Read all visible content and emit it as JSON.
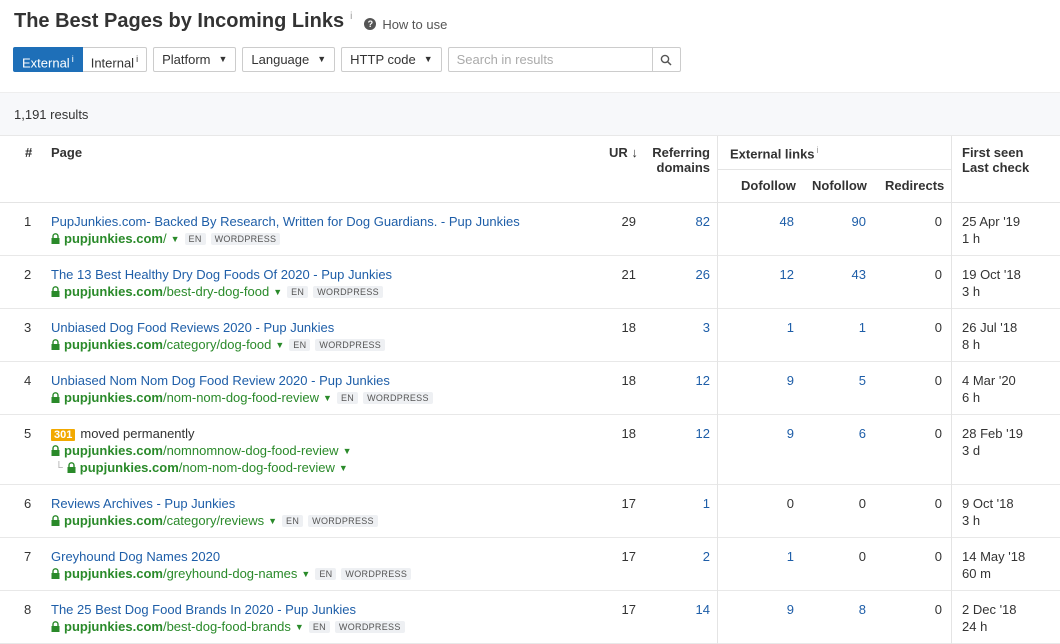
{
  "header": {
    "title": "The Best Pages by Incoming Links",
    "title_info": "i",
    "how_to_use": "How to use"
  },
  "toolbar": {
    "external_label": "External",
    "internal_label": "Internal",
    "info_glyph": "i",
    "platform_label": "Platform",
    "language_label": "Language",
    "http_code_label": "HTTP code",
    "search_placeholder": "Search in results"
  },
  "results": {
    "count_label": "1,191 results"
  },
  "table": {
    "headers": {
      "num": "#",
      "page": "Page",
      "ur": "UR",
      "ur_sort": "↓",
      "referring_1": "Referring",
      "referring_2": "domains",
      "external_links": "External links",
      "external_info": "i",
      "dofollow": "Dofollow",
      "nofollow": "Nofollow",
      "redirects": "Redirects",
      "first_seen": "First seen",
      "last_check": "Last check"
    },
    "rows": [
      {
        "n": "1",
        "title": "PupJunkies.com- Backed By Research, Written for Dog Guardians. - Pup Junkies",
        "domain": "pupjunkies.com",
        "path": "/",
        "lang": "EN",
        "platform": "WORDPRESS",
        "ur": "29",
        "ref": "82",
        "dofollow": "48",
        "nofollow": "90",
        "redirects": "0",
        "first_seen": "25 Apr '19",
        "last_check": "1 h"
      },
      {
        "n": "2",
        "title": "The 13 Best Healthy Dry Dog Foods Of 2020 - Pup Junkies",
        "domain": "pupjunkies.com",
        "path": "/best-dry-dog-food",
        "lang": "EN",
        "platform": "WORDPRESS",
        "ur": "21",
        "ref": "26",
        "dofollow": "12",
        "nofollow": "43",
        "redirects": "0",
        "first_seen": "19 Oct '18",
        "last_check": "3 h"
      },
      {
        "n": "3",
        "title": "Unbiased Dog Food Reviews 2020 - Pup Junkies",
        "domain": "pupjunkies.com",
        "path": "/category/dog-food",
        "lang": "EN",
        "platform": "WORDPRESS",
        "ur": "18",
        "ref": "3",
        "dofollow": "1",
        "nofollow": "1",
        "redirects": "0",
        "first_seen": "26 Jul '18",
        "last_check": "8 h"
      },
      {
        "n": "4",
        "title": "Unbiased Nom Nom Dog Food Review 2020 - Pup Junkies",
        "domain": "pupjunkies.com",
        "path": "/nom-nom-dog-food-review",
        "lang": "EN",
        "platform": "WORDPRESS",
        "ur": "18",
        "ref": "12",
        "dofollow": "9",
        "nofollow": "5",
        "redirects": "0",
        "first_seen": "4 Mar '20",
        "last_check": "6 h"
      },
      {
        "n": "5",
        "status_code": "301",
        "status_text": "moved permanently",
        "domain": "pupjunkies.com",
        "path": "/nomnomnow-dog-food-review",
        "redirect_domain": "pupjunkies.com",
        "redirect_path": "/nom-nom-dog-food-review",
        "ur": "18",
        "ref": "12",
        "dofollow": "9",
        "nofollow": "6",
        "redirects": "0",
        "first_seen": "28 Feb '19",
        "last_check": "3 d"
      },
      {
        "n": "6",
        "title": "Reviews Archives - Pup Junkies",
        "domain": "pupjunkies.com",
        "path": "/category/reviews",
        "lang": "EN",
        "platform": "WORDPRESS",
        "ur": "17",
        "ref": "1",
        "dofollow": "0",
        "nofollow": "0",
        "redirects": "0",
        "first_seen": "9 Oct '18",
        "last_check": "3 h"
      },
      {
        "n": "7",
        "title": "Greyhound Dog Names 2020",
        "domain": "pupjunkies.com",
        "path": "/greyhound-dog-names",
        "lang": "EN",
        "platform": "WORDPRESS",
        "ur": "17",
        "ref": "2",
        "dofollow": "1",
        "nofollow": "0",
        "redirects": "0",
        "first_seen": "14 May '18",
        "last_check": "60 m"
      },
      {
        "n": "8",
        "title": "The 25 Best Dog Food Brands In 2020 - Pup Junkies",
        "domain": "pupjunkies.com",
        "path": "/best-dog-food-brands",
        "lang": "EN",
        "platform": "WORDPRESS",
        "ur": "17",
        "ref": "14",
        "dofollow": "9",
        "nofollow": "8",
        "redirects": "0",
        "first_seen": "2 Dec '18",
        "last_check": "24 h"
      }
    ]
  }
}
